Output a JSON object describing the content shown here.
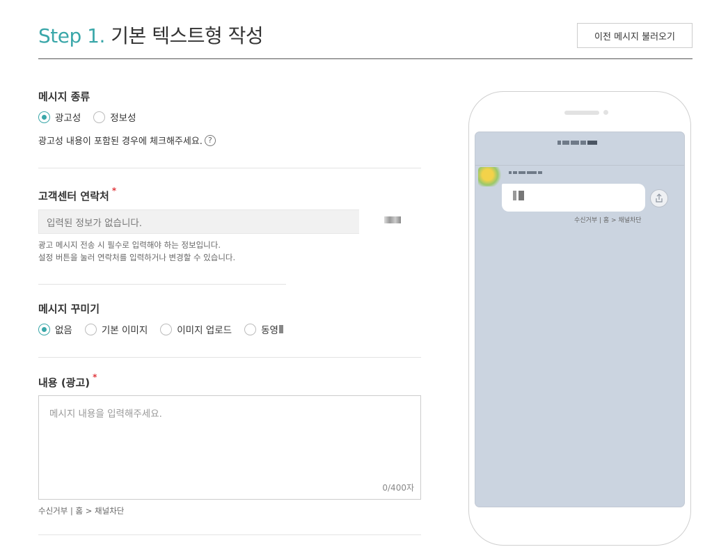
{
  "header": {
    "step_label": "Step 1.",
    "title": "기본 텍스트형 작성",
    "load_prev_button": "이전 메시지 불러오기"
  },
  "message_type": {
    "title": "메시지 종류",
    "options": [
      "광고성",
      "정보성"
    ],
    "selected": "광고성",
    "hint": "광고성 내용이 포함된 경우에 체크해주세요.",
    "help_icon": "?"
  },
  "contact": {
    "title": "고객센터 연락처",
    "required_mark": "*",
    "placeholder": "입력된 정보가 없습니다.",
    "note_line1": "광고 메시지 전송 시 필수로 입력해야 하는 정보입니다.",
    "note_line2": "설정 버튼을 눌러 연락처를 입력하거나 변경할 수 있습니다."
  },
  "decoration": {
    "title": "메시지 꾸미기",
    "options": [
      "없음",
      "기본 이미지",
      "이미지 업로드",
      "동영"
    ],
    "selected": "없음"
  },
  "content": {
    "title": "내용 (광고)",
    "required_mark": "*",
    "placeholder": "메시지 내용을 입력해주세요.",
    "char_count": "0/400자"
  },
  "footer_text": "수신거부 | 홈 > 채널차단",
  "preview": {
    "footer_text": "수신거부 | 홈 > 채널차단",
    "share_icon": "share-icon"
  },
  "colors": {
    "accent": "#3aa7a9",
    "required": "#e0393e",
    "preview_bg": "#cbd4e0"
  }
}
